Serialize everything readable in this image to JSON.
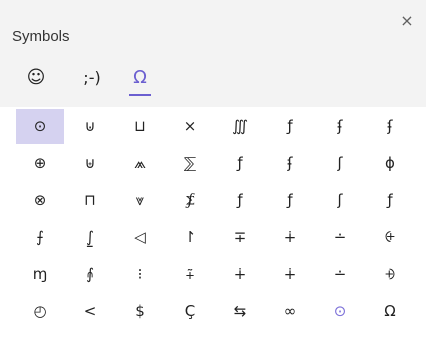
{
  "panel": {
    "title": "Symbols",
    "close_glyph": "×"
  },
  "tabs": [
    {
      "label": "☺",
      "name": "tab-emoji",
      "active": false
    },
    {
      "label": ";-)",
      "name": "tab-kaomoji",
      "active": false
    },
    {
      "label": "Ω",
      "name": "tab-symbols",
      "active": true
    }
  ],
  "symbols": [
    [
      "⊙",
      "⊍",
      "⊔",
      "×",
      "∭",
      "ƒ",
      "ʄ",
      "ʄ"
    ],
    [
      "⊕",
      "⊎",
      "⩕",
      "⅀",
      "ƒ",
      "ʄ",
      "ʃ",
      "ɸ"
    ],
    [
      "⊗",
      "⊓",
      "⩔",
      "⨋",
      "ƒ",
      "ƒ",
      "ʃ",
      "ƒ"
    ],
    [
      "⨍",
      "⨜",
      "◁",
      "↾",
      "∓",
      "∔",
      "∸",
      "⨭"
    ],
    [
      "ɱ",
      "⨙",
      "⁝",
      "⨤",
      "∔",
      "∔",
      "∸",
      "⨮"
    ],
    [
      "◴",
      "<",
      "$",
      "Ç",
      "⇆",
      "∞",
      "⊙",
      "Ω"
    ]
  ],
  "accent_color": "#6b5fd0",
  "selected_color": "#d5d2f0"
}
